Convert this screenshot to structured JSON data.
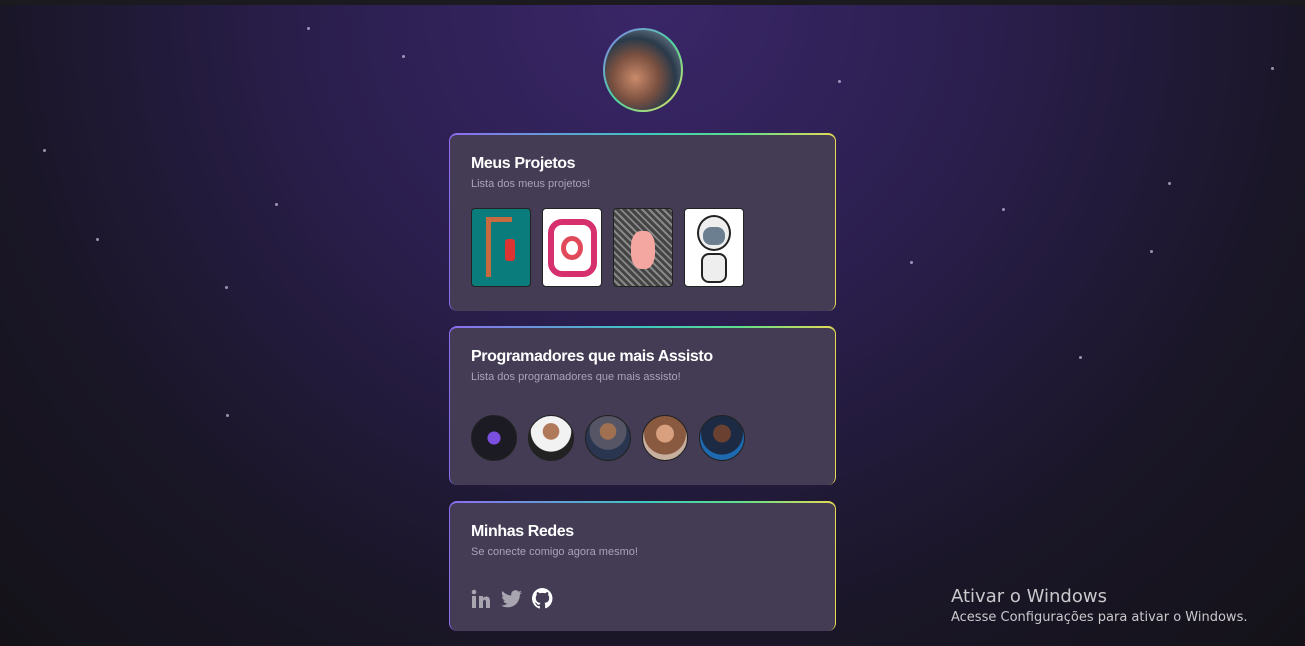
{
  "projects_card": {
    "title": "Meus Projetos",
    "subtitle": "Lista dos meus projetos!",
    "items": [
      {
        "icon": "hangman-game-icon"
      },
      {
        "icon": "instagram-clone-icon"
      },
      {
        "icon": "noise-image-icon"
      },
      {
        "icon": "robot-icon"
      }
    ]
  },
  "devs_card": {
    "title": "Programadores que mais Assisto",
    "subtitle": "Lista dos programadores que mais assisto!"
  },
  "social_card": {
    "title": "Minhas Redes",
    "subtitle": "Se conecte comigo agora mesmo!",
    "links": [
      "linkedin-icon",
      "twitter-icon",
      "github-icon"
    ]
  },
  "windows_watermark": {
    "title": "Ativar o Windows",
    "subtitle": "Acesse Configurações para ativar o Windows."
  },
  "colors": {
    "card": "#433c54",
    "gradient": [
      "#8d6cf0",
      "#3ec7c0",
      "#5ee08a",
      "#e6da55"
    ]
  }
}
